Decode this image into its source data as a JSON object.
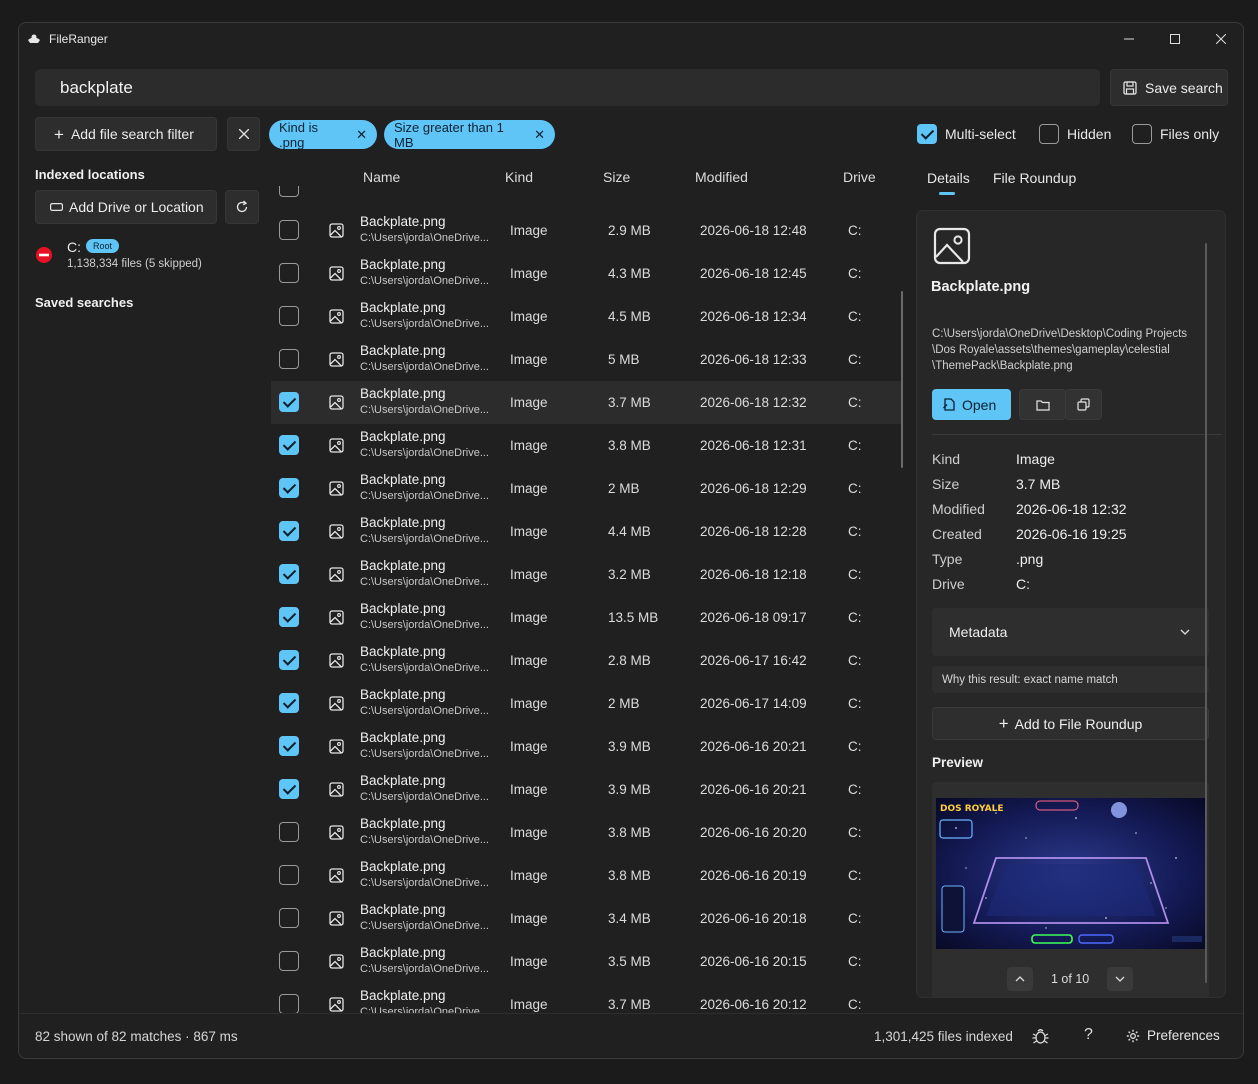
{
  "app": {
    "title": "FileRanger"
  },
  "search": {
    "query": "backplate",
    "save_label": "Save search"
  },
  "filters": {
    "add_label": "Add file search filter",
    "chips": [
      "Kind is .png",
      "Size greater than 1 MB"
    ],
    "multiselect_label": "Multi-select",
    "multiselect_checked": true,
    "hidden_label": "Hidden",
    "files_only_label": "Files only"
  },
  "sidebar": {
    "indexed_title": "Indexed locations",
    "add_drive_label": "Add Drive or Location",
    "drive_name": "C:",
    "drive_badge": "Root",
    "drive_stats": "1,138,334 files (5 skipped)",
    "saved_title": "Saved searches"
  },
  "columns": {
    "name": "Name",
    "kind": "Kind",
    "size": "Size",
    "modified": "Modified",
    "drive": "Drive"
  },
  "rows": [
    {
      "name": "Backplate.png",
      "path": "C:\\Users\\jorda\\OneDrive...",
      "kind": "Image",
      "size": "2.9 MB",
      "modified": "2026-06-18 12:48",
      "drive": "C:",
      "checked": false
    },
    {
      "name": "Backplate.png",
      "path": "C:\\Users\\jorda\\OneDrive...",
      "kind": "Image",
      "size": "4.3 MB",
      "modified": "2026-06-18 12:45",
      "drive": "C:",
      "checked": false
    },
    {
      "name": "Backplate.png",
      "path": "C:\\Users\\jorda\\OneDrive...",
      "kind": "Image",
      "size": "4.5 MB",
      "modified": "2026-06-18 12:34",
      "drive": "C:",
      "checked": false
    },
    {
      "name": "Backplate.png",
      "path": "C:\\Users\\jorda\\OneDrive...",
      "kind": "Image",
      "size": "5 MB",
      "modified": "2026-06-18 12:33",
      "drive": "C:",
      "checked": false
    },
    {
      "name": "Backplate.png",
      "path": "C:\\Users\\jorda\\OneDrive...",
      "kind": "Image",
      "size": "3.7 MB",
      "modified": "2026-06-18 12:32",
      "drive": "C:",
      "checked": true,
      "selected": true
    },
    {
      "name": "Backplate.png",
      "path": "C:\\Users\\jorda\\OneDrive...",
      "kind": "Image",
      "size": "3.8 MB",
      "modified": "2026-06-18 12:31",
      "drive": "C:",
      "checked": true
    },
    {
      "name": "Backplate.png",
      "path": "C:\\Users\\jorda\\OneDrive...",
      "kind": "Image",
      "size": "2 MB",
      "modified": "2026-06-18 12:29",
      "drive": "C:",
      "checked": true
    },
    {
      "name": "Backplate.png",
      "path": "C:\\Users\\jorda\\OneDrive...",
      "kind": "Image",
      "size": "4.4 MB",
      "modified": "2026-06-18 12:28",
      "drive": "C:",
      "checked": true
    },
    {
      "name": "Backplate.png",
      "path": "C:\\Users\\jorda\\OneDrive...",
      "kind": "Image",
      "size": "3.2 MB",
      "modified": "2026-06-18 12:18",
      "drive": "C:",
      "checked": true
    },
    {
      "name": "Backplate.png",
      "path": "C:\\Users\\jorda\\OneDrive...",
      "kind": "Image",
      "size": "13.5 MB",
      "modified": "2026-06-18 09:17",
      "drive": "C:",
      "checked": true
    },
    {
      "name": "Backplate.png",
      "path": "C:\\Users\\jorda\\OneDrive...",
      "kind": "Image",
      "size": "2.8 MB",
      "modified": "2026-06-17 16:42",
      "drive": "C:",
      "checked": true
    },
    {
      "name": "Backplate.png",
      "path": "C:\\Users\\jorda\\OneDrive...",
      "kind": "Image",
      "size": "2 MB",
      "modified": "2026-06-17 14:09",
      "drive": "C:",
      "checked": true
    },
    {
      "name": "Backplate.png",
      "path": "C:\\Users\\jorda\\OneDrive...",
      "kind": "Image",
      "size": "3.9 MB",
      "modified": "2026-06-16 20:21",
      "drive": "C:",
      "checked": true
    },
    {
      "name": "Backplate.png",
      "path": "C:\\Users\\jorda\\OneDrive...",
      "kind": "Image",
      "size": "3.9 MB",
      "modified": "2026-06-16 20:21",
      "drive": "C:",
      "checked": true
    },
    {
      "name": "Backplate.png",
      "path": "C:\\Users\\jorda\\OneDrive...",
      "kind": "Image",
      "size": "3.8 MB",
      "modified": "2026-06-16 20:20",
      "drive": "C:",
      "checked": false
    },
    {
      "name": "Backplate.png",
      "path": "C:\\Users\\jorda\\OneDrive...",
      "kind": "Image",
      "size": "3.8 MB",
      "modified": "2026-06-16 20:19",
      "drive": "C:",
      "checked": false
    },
    {
      "name": "Backplate.png",
      "path": "C:\\Users\\jorda\\OneDrive...",
      "kind": "Image",
      "size": "3.4 MB",
      "modified": "2026-06-16 20:18",
      "drive": "C:",
      "checked": false
    },
    {
      "name": "Backplate.png",
      "path": "C:\\Users\\jorda\\OneDrive...",
      "kind": "Image",
      "size": "3.5 MB",
      "modified": "2026-06-16 20:15",
      "drive": "C:",
      "checked": false
    },
    {
      "name": "Backplate.png",
      "path": "C:\\Users\\jorda\\OneDrive...",
      "kind": "Image",
      "size": "3.7 MB",
      "modified": "2026-06-16 20:12",
      "drive": "C:",
      "checked": false
    }
  ],
  "details": {
    "tab_details": "Details",
    "tab_roundup": "File Roundup",
    "file_name": "Backplate.png",
    "path_line1": "C:\\Users\\jorda\\OneDrive\\Desktop\\Coding Projects",
    "path_line2": "\\Dos Royale\\assets\\themes\\gameplay\\celestial",
    "path_line3": "\\ThemePack\\Backplate.png",
    "open_label": "Open",
    "kind_key": "Kind",
    "kind_val": "Image",
    "size_key": "Size",
    "size_val": "3.7 MB",
    "modified_key": "Modified",
    "modified_val": "2026-06-18 12:32",
    "created_key": "Created",
    "created_val": "2026-06-16 19:25",
    "type_key": "Type",
    "type_val": ".png",
    "drive_key": "Drive",
    "drive_val": "C:",
    "metadata_label": "Metadata",
    "why_label": "Why this result:  exact name match",
    "add_roundup_label": "Add to File Roundup",
    "preview_title": "Preview",
    "preview_game_title": "DOS ROYALE",
    "pager": "1 of 10"
  },
  "status": {
    "shown": "82 shown of 82 matches · 867 ms",
    "indexed": "1,301,425 files indexed",
    "help": "?",
    "preferences": "Preferences"
  },
  "colors": {
    "accent": "#5fc4f6",
    "background": "#202020",
    "panel": "#272727"
  }
}
